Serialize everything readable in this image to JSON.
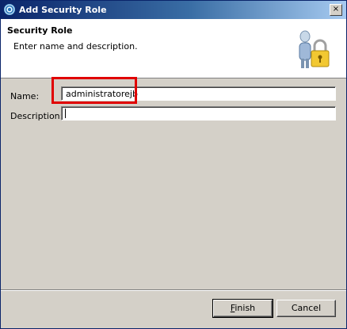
{
  "window": {
    "title": "Add Security Role",
    "close_glyph": "×"
  },
  "banner": {
    "title": "Security Role",
    "description": "Enter name and description.",
    "icon": "user-lock-icon"
  },
  "form": {
    "name_label": "Name:",
    "name_value": "administratorejb",
    "description_label": "Description:",
    "description_value": ""
  },
  "buttons": {
    "finish_mnemonic": "F",
    "finish_rest": "inish",
    "cancel_label": "Cancel"
  },
  "colors": {
    "highlight": "#e00000",
    "title_bar": "#0a246a"
  }
}
